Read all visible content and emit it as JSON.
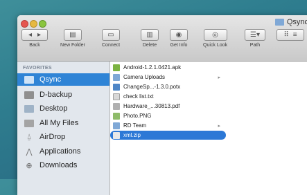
{
  "window": {
    "title": "Qsync"
  },
  "toolbar": {
    "back_label": "Back",
    "new_folder_label": "New Folder",
    "connect_label": "Connect",
    "delete_label": "Delete",
    "get_info_label": "Get Info",
    "quick_look_label": "Quick Look",
    "path_label": "Path"
  },
  "sidebar": {
    "heading": "FAVORITES",
    "items": [
      {
        "label": "Qsync",
        "icon": "folder-icon",
        "selected": true
      },
      {
        "label": "D-backup",
        "icon": "disk-icon"
      },
      {
        "label": "Desktop",
        "icon": "folder-icon"
      },
      {
        "label": "All My Files",
        "icon": "files-icon"
      },
      {
        "label": "AirDrop",
        "icon": "airdrop-icon"
      },
      {
        "label": "Applications",
        "icon": "applications-icon"
      },
      {
        "label": "Downloads",
        "icon": "downloads-icon"
      }
    ]
  },
  "files": [
    {
      "name": "Android-1.2.1.0421.apk",
      "icon": "apk-file-icon"
    },
    {
      "name": "Camera Uploads",
      "icon": "folder-icon",
      "is_folder": true
    },
    {
      "name": "ChangeSp...-1.3.0.potx",
      "icon": "potx-file-icon"
    },
    {
      "name": "check list.txt",
      "icon": "txt-file-icon"
    },
    {
      "name": "Hardware_...30813.pdf",
      "icon": "pdf-file-icon"
    },
    {
      "name": "Photo.PNG",
      "icon": "image-file-icon"
    },
    {
      "name": "RD Team",
      "icon": "folder-icon",
      "is_folder": true
    },
    {
      "name": "xml.zip",
      "icon": "zip-file-icon",
      "selected": true
    }
  ],
  "colors": {
    "selection": "#2f84d6",
    "sidebar_bg": "#e2e7ed",
    "desktop": "#2f7e8f"
  }
}
